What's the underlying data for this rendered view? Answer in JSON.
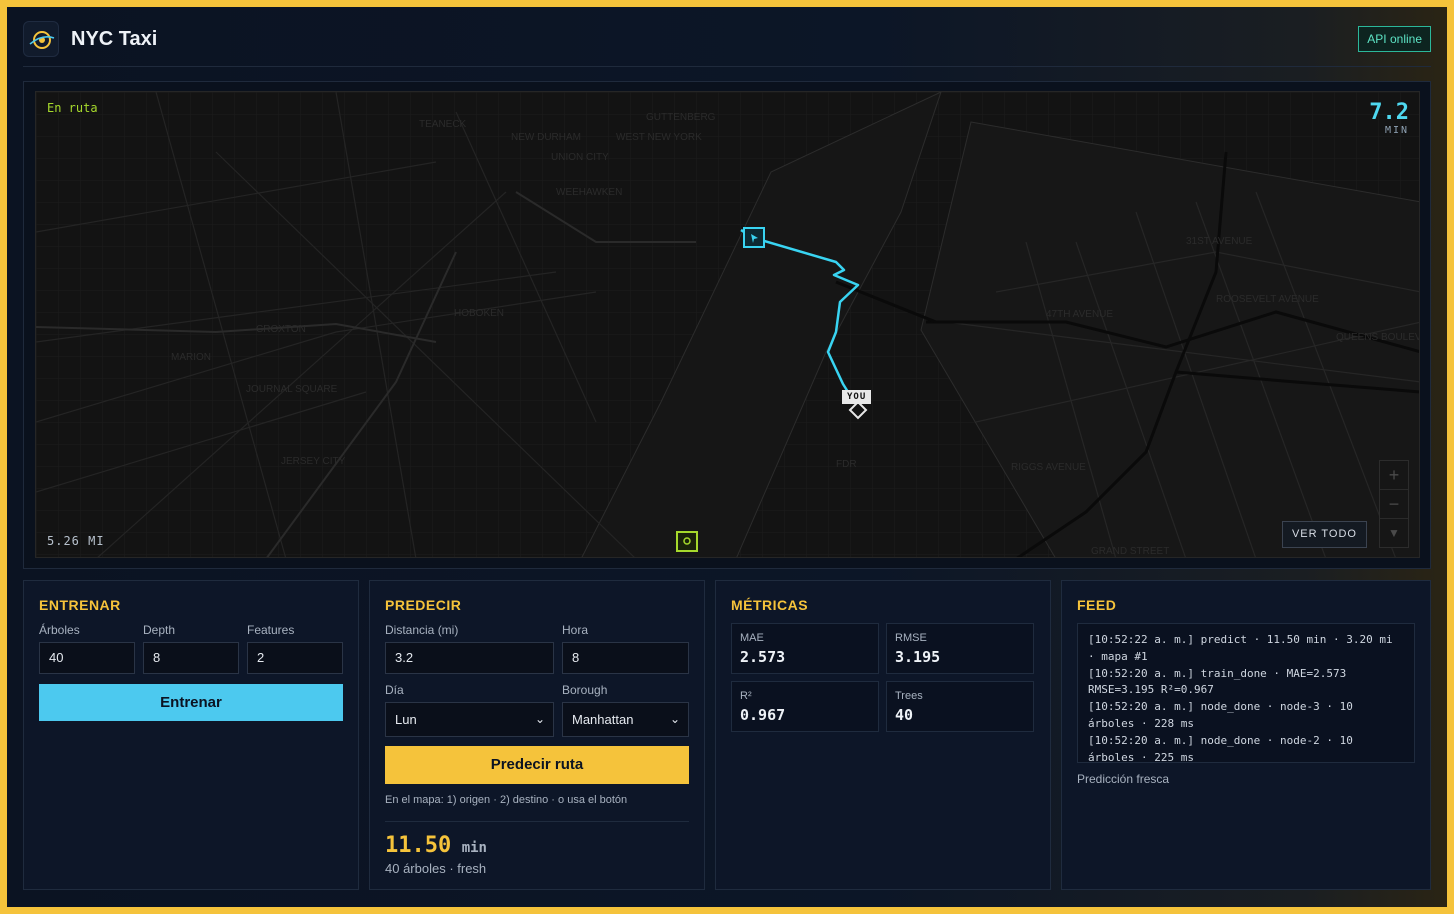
{
  "app": {
    "title": "NYC Taxi",
    "api_status": "API online"
  },
  "map": {
    "status": "En ruta",
    "eta_value": "7.2",
    "eta_unit": "MIN",
    "distance": "5.26 MI",
    "you_label": "YOU",
    "view_all_label": "VER TODO",
    "zoom_in": "+",
    "zoom_out": "−",
    "compass": "▼",
    "place_labels": [
      "CROXTON",
      "MARION",
      "JOURNAL SQUARE",
      "JERSEY CITY",
      "HOBOKEN",
      "WEEHAWKEN",
      "UNION CITY",
      "WEST NEW YORK",
      "GUTTENBERG",
      "NEW DURHAM",
      "TEANECK",
      "47TH AVENUE",
      "31ST AVENUE",
      "ROOSEVELT AVENUE",
      "QUEENS BOULEVARD",
      "RIGGS AVENUE",
      "GRAND STREET",
      "FDR",
      "UNION CITY"
    ]
  },
  "train": {
    "title": "ENTRENAR",
    "trees_label": "Árboles",
    "trees_value": "40",
    "depth_label": "Depth",
    "depth_value": "8",
    "features_label": "Features",
    "features_value": "2",
    "button": "Entrenar"
  },
  "predict": {
    "title": "PREDECIR",
    "distance_label": "Distancia (mi)",
    "distance_value": "3.2",
    "hour_label": "Hora",
    "hour_value": "8",
    "day_label": "Día",
    "day_value": "Lun",
    "borough_label": "Borough",
    "borough_value": "Manhattan",
    "button": "Predecir ruta",
    "hint": "En el mapa: 1) origen · 2) destino · o usa el botón",
    "result_value": "11.50",
    "result_unit": "min",
    "result_meta": "40 árboles · fresh"
  },
  "metrics": {
    "title": "MÉTRICAS",
    "mae_label": "MAE",
    "mae_value": "2.573",
    "rmse_label": "RMSE",
    "rmse_value": "3.195",
    "r2_label": "R²",
    "r2_value": "0.967",
    "trees_label": "Trees",
    "trees_value": "40"
  },
  "feed": {
    "title": "FEED",
    "lines": [
      "[10:52:22 a. m.] predict · 11.50 min · 3.20 mi · mapa #1",
      "[10:52:20 a. m.] train_done · MAE=2.573 RMSE=3.195 R²=0.967",
      "[10:52:20 a. m.] node_done · node-3 · 10 árboles · 228 ms",
      "[10:52:20 a. m.] node_done · node-2 · 10 árboles · 225 ms"
    ],
    "footer": "Predicción fresca"
  },
  "colors": {
    "accent_yellow": "#f5c33b",
    "accent_cyan": "#4cc9ef",
    "route": "#39d4f2",
    "status_green": "#a6d92c",
    "api_teal": "#5de3c4"
  }
}
